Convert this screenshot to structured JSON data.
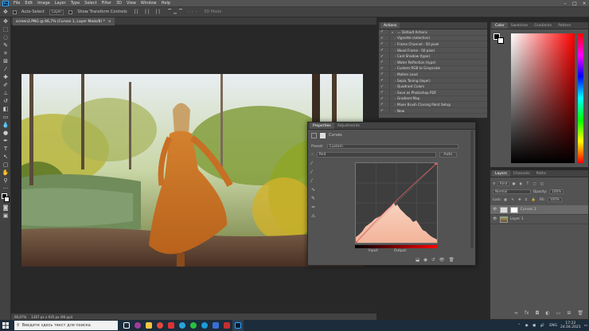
{
  "menubar": {
    "app_icon": "Ps",
    "items": [
      "File",
      "Edit",
      "Image",
      "Layer",
      "Type",
      "Select",
      "Filter",
      "3D",
      "View",
      "Window",
      "Help"
    ]
  },
  "optionsbar": {
    "auto_select": "Auto-Select",
    "layer_dd": "Layer",
    "show_transform": "Show Transform Controls",
    "mode": "3D Mode"
  },
  "document": {
    "tab_title": "screen2.PNG @ 66,7% (Curves 1, Layer Mask/8) *",
    "zoom": "66,67%",
    "size": "1367 px x 935 px (96 ppi)"
  },
  "actions_panel": {
    "tab": "Actions",
    "set_name": "Default Actions",
    "items": [
      "Vignette (selection)",
      "Frame Channel - 50 pixel",
      "Wood Frame - 50 pixel",
      "Cast Shadow (type)",
      "Water Reflection (type)",
      "Custom RGB to Grayscale",
      "Molten Lead",
      "Sepia Toning (layer)",
      "Quadrant Colors",
      "Save as Photoshop PDF",
      "Gradient Map",
      "Mixer Brush Cloning Paint Setup",
      "New"
    ]
  },
  "color_panel": {
    "tabs": [
      "Color",
      "Swatches",
      "Gradients",
      "Pattern"
    ]
  },
  "layers_panel": {
    "tabs": [
      "Layers",
      "Channels",
      "Paths"
    ],
    "kind_label": "Kind",
    "blend_mode": "Normal",
    "opacity_label": "Opacity:",
    "opacity": "100%",
    "lock_label": "Lock:",
    "fill_label": "Fill:",
    "fill": "100%",
    "layers": [
      {
        "name": "Curves 1",
        "selected": true
      },
      {
        "name": "Layer 1",
        "selected": false
      }
    ]
  },
  "properties_panel": {
    "tabs": [
      "Properties",
      "Adjustments"
    ],
    "title": "Curves",
    "preset_label": "Preset:",
    "preset": "Custom",
    "channel": "Red",
    "auto_button": "Auto",
    "input_label": "Input:",
    "output_label": "Output:"
  },
  "taskbar": {
    "search_placeholder": "Введите здесь текст для поиска",
    "lang": "ENG",
    "time": "17:22",
    "date": "24.04.2021"
  },
  "colors": {
    "accent": "#31a8ff",
    "histogram": "#f6c2ac",
    "red_curve": "#e06060"
  }
}
